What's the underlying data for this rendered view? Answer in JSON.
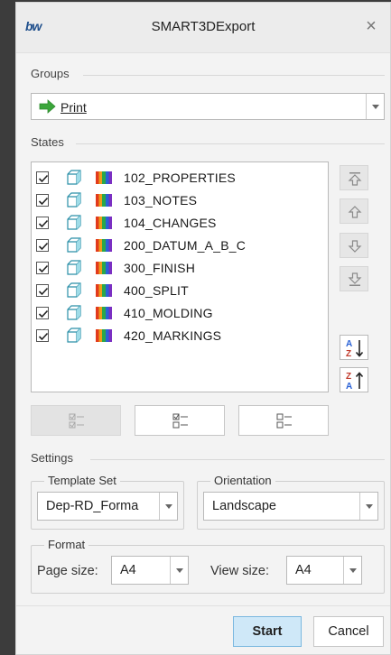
{
  "window": {
    "title": "SMART3DExport",
    "logo_text": "bw",
    "close_glyph": "×"
  },
  "groups": {
    "label": "Groups",
    "selected": "Print",
    "selected_icon": "green-arrow-icon"
  },
  "states": {
    "label": "States",
    "items": [
      {
        "label": "102_PROPERTIES",
        "checked": true
      },
      {
        "label": "103_NOTES",
        "checked": true
      },
      {
        "label": "104_CHANGES",
        "checked": true
      },
      {
        "label": "200_DATUM_A_B_C",
        "checked": true
      },
      {
        "label": "300_FINISH",
        "checked": true
      },
      {
        "label": "400_SPLIT",
        "checked": true
      },
      {
        "label": "410_MOLDING",
        "checked": true
      },
      {
        "label": "420_MARKINGS",
        "checked": true
      }
    ],
    "side_buttons": [
      "move-top-icon",
      "move-up-icon",
      "move-down-icon",
      "move-bottom-icon"
    ],
    "sort_buttons": [
      "sort-az-icon",
      "sort-za-icon"
    ],
    "selection_buttons": [
      "select-all-icon",
      "invert-selection-icon",
      "deselect-all-icon"
    ]
  },
  "settings": {
    "label": "Settings",
    "template_set": {
      "legend": "Template Set",
      "value": "Dep-RD_Forma"
    },
    "orientation": {
      "legend": "Orientation",
      "value": "Landscape"
    },
    "format": {
      "legend": "Format",
      "page_size_label": "Page size:",
      "page_size_value": "A4",
      "view_size_label": "View size:",
      "view_size_value": "A4"
    }
  },
  "footer": {
    "start_label": "Start",
    "cancel_label": "Cancel"
  },
  "colors": {
    "dialog_bg": "#f3f3f3",
    "start_bg": "#cfe8f8",
    "start_border": "#7bb8e0",
    "arrow_green": "#3ba63b"
  }
}
